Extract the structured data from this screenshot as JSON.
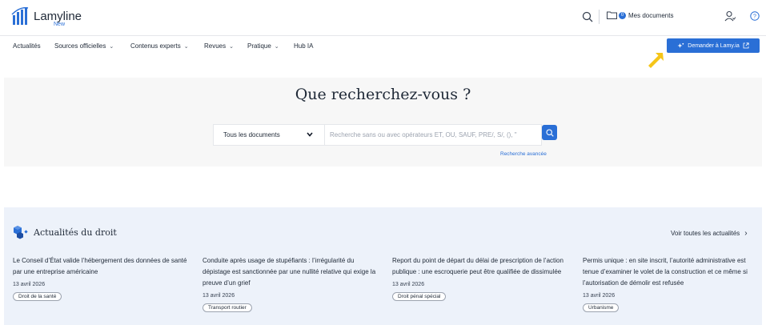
{
  "header": {
    "brand": "Lamyline",
    "brand_sub": "New",
    "docs_badge": "0",
    "docs_label": "Mes documents"
  },
  "nav": {
    "items": [
      {
        "label": "Actualités",
        "dropdown": false
      },
      {
        "label": "Sources officielles",
        "dropdown": true
      },
      {
        "label": "Contenus experts",
        "dropdown": true
      },
      {
        "label": "Revues",
        "dropdown": true
      },
      {
        "label": "Pratique",
        "dropdown": true
      },
      {
        "label": "Hub IA",
        "dropdown": false
      }
    ],
    "ask_label": "Demander à Lamy.ia"
  },
  "search": {
    "title": "Que recherchez-vous ?",
    "scope_selected": "Tous les documents",
    "placeholder": "Recherche sans ou avec opérateurs ET, OU, SAUF, PRE/, S/, (), \"",
    "advanced_link": "Recherche avancée"
  },
  "news": {
    "title": "Actualités du droit",
    "see_all": "Voir toutes les actualités",
    "cards": [
      {
        "title": "Le Conseil d’État valide l’hébergement des données de santé par une entreprise américaine",
        "date": "13 avril 2026",
        "tag": "Droit de la santé"
      },
      {
        "title": "Conduite après usage de stupéfiants : l’irrégularité du dépistage est sanctionnée par une nullité relative qui exige la preuve d’un grief",
        "date": "13 avril 2026",
        "tag": "Transport routier"
      },
      {
        "title": "Report du point de départ du délai de prescription de l’action publique : une escroquerie peut être qualifiée de dissimulée",
        "date": "13 avril 2026",
        "tag": "Droit pénal spécial"
      },
      {
        "title": "Permis unique : en site inscrit, l’autorité administrative est tenue d’examiner le volet de la construction et ce même si l’autorisation de démolir est refusée",
        "date": "13 avril 2026",
        "tag": "Urbanisme"
      }
    ]
  },
  "colors": {
    "accent": "#2a6fd6",
    "arrow": "#f5c518",
    "news_bg": "#edf2fa",
    "hero_bg": "#f7f7f7"
  }
}
